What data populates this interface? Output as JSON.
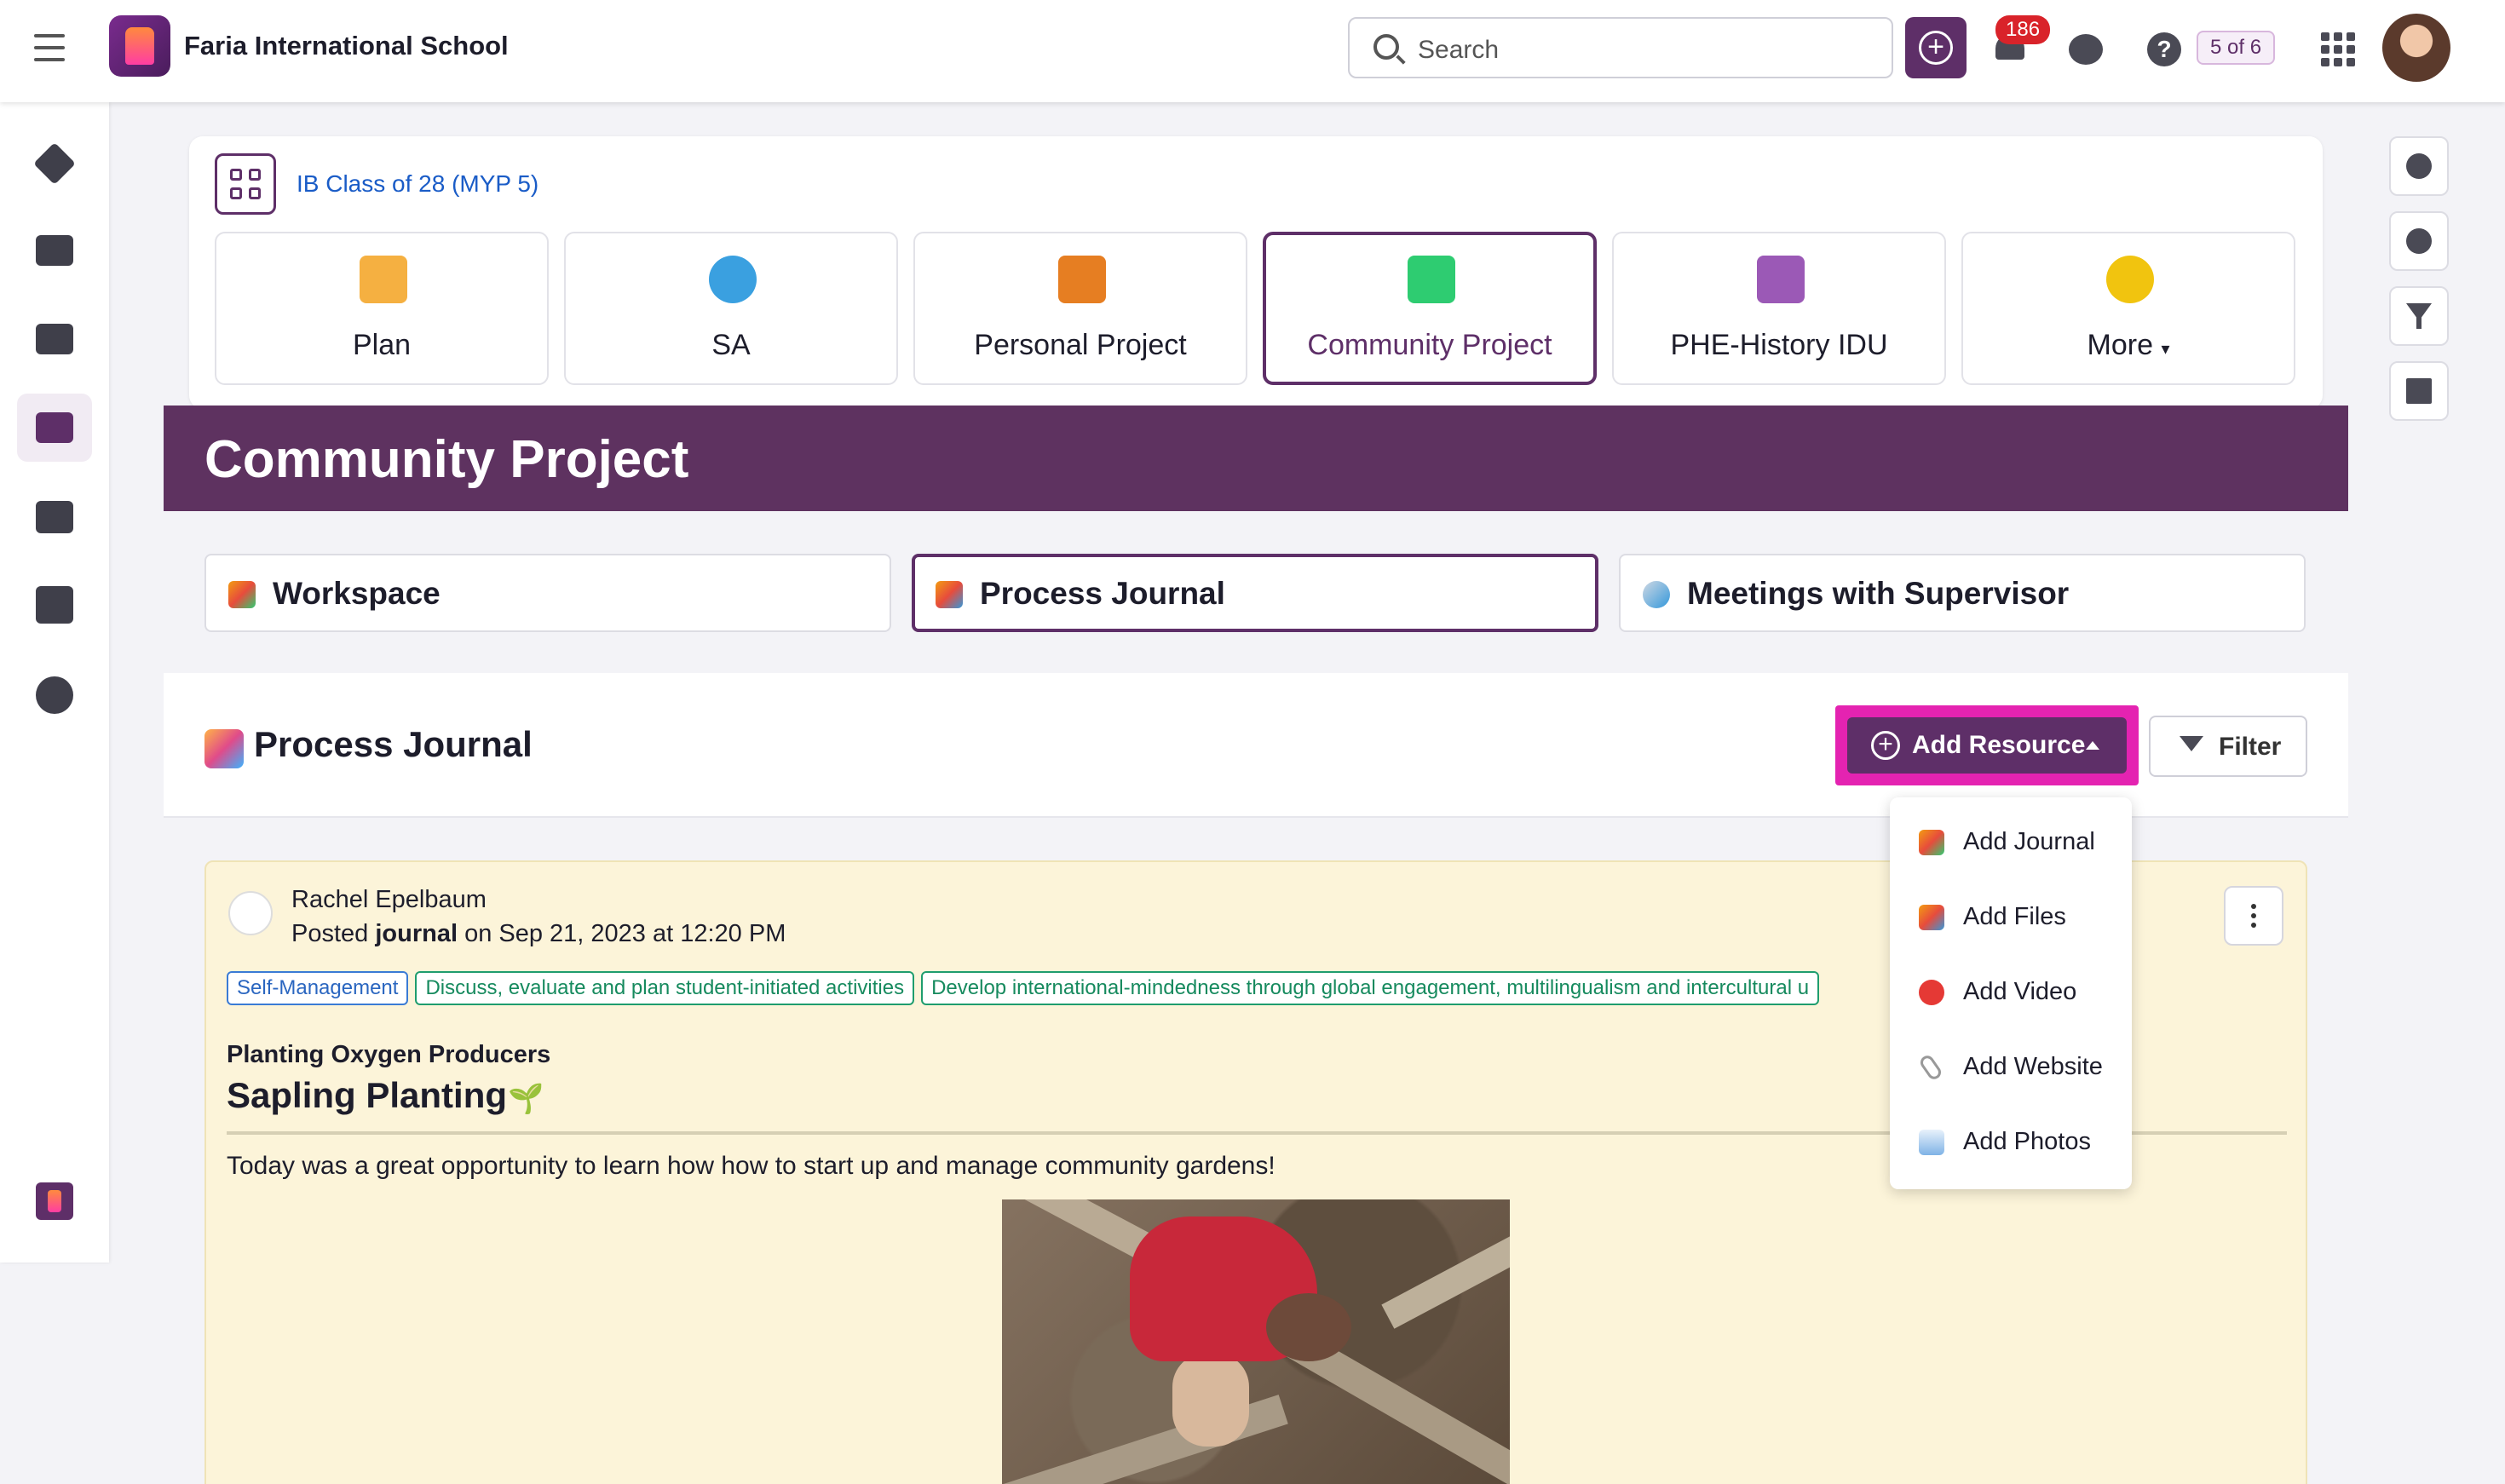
{
  "app": {
    "school_name": "Faria International School",
    "search_placeholder": "Search",
    "notification_count": "186",
    "pager": "5 of 6"
  },
  "class": {
    "name": "IB Class of 28 (MYP 5)"
  },
  "program_tiles": [
    {
      "label": "Plan",
      "icon": "folder-portrait-icon",
      "color": "#f5b041"
    },
    {
      "label": "SA",
      "icon": "globe-icon",
      "color": "#3aa0e0"
    },
    {
      "label": "Personal Project",
      "icon": "notebook-icon",
      "color": "#e67e22"
    },
    {
      "label": "Community Project",
      "icon": "green-books-icon",
      "color": "#2ecc71",
      "selected": true
    },
    {
      "label": "PHE-History IDU",
      "icon": "puzzle-icon",
      "color": "#9b59b6"
    },
    {
      "label": "More",
      "icon": "lightbulb-icon",
      "color": "#f1c40f"
    }
  ],
  "banner": {
    "title": "Community Project"
  },
  "sub_tabs": [
    {
      "label": "Workspace",
      "icon": "pencil-tools-icon"
    },
    {
      "label": "Process Journal",
      "icon": "masks-icon",
      "selected": true
    },
    {
      "label": "Meetings with Supervisor",
      "icon": "speech-bubbles-icon"
    }
  ],
  "section": {
    "title": "Process Journal",
    "add_resource_label": "Add Resource",
    "filter_label": "Filter"
  },
  "dropdown": {
    "items": [
      {
        "label": "Add Journal",
        "icon": "pencil-tools-icon"
      },
      {
        "label": "Add Files",
        "icon": "masks-icon"
      },
      {
        "label": "Add Video",
        "icon": "play-icon"
      },
      {
        "label": "Add Website",
        "icon": "paperclip-icon"
      },
      {
        "label": "Add Photos",
        "icon": "photo-icon"
      }
    ]
  },
  "post": {
    "author": "Rachel Epelbaum",
    "posted_prefix": "Posted ",
    "posted_type": "journal",
    "posted_suffix": " on Sep 21, 2023 at 12:20 PM",
    "tags": [
      {
        "label": "Self-Management",
        "style": "blue"
      },
      {
        "label": "Discuss, evaluate and plan student-initiated activities",
        "style": "green"
      },
      {
        "label": "Develop international-mindedness through global engagement, multilingualism and intercultural u",
        "style": "green"
      }
    ],
    "subtitle": "Planting Oxygen Producers",
    "title": "Sapling Planting",
    "body": "Today was a great opportunity to learn how how to start up and manage community gardens!"
  },
  "colors": {
    "brand": "#5e2f68",
    "highlight": "#e423b1",
    "post_bg": "#fcf4d9"
  }
}
